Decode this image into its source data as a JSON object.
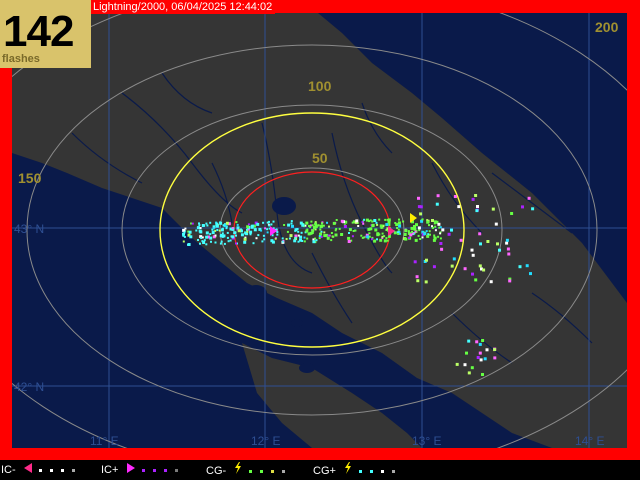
{
  "header": {
    "title": "Lightning/2000, 06/04/2025 12:44:02",
    "flash_count": "142",
    "flash_unit": "flashes"
  },
  "map": {
    "range_rings": [
      {
        "label": "50",
        "color": "#aaaaaa"
      },
      {
        "label": "100",
        "color": "#aaaaaa"
      },
      {
        "label": "150",
        "color": "#aaaaaa"
      },
      {
        "label": "200",
        "color": "#aaaaaa"
      }
    ],
    "alarm_rings": [
      {
        "color": "#ff2020"
      },
      {
        "color": "#ffff40"
      }
    ],
    "latitude_labels": [
      "43° N",
      "42° N"
    ],
    "longitude_labels": [
      "11° E",
      "12° E",
      "13° E",
      "14° E"
    ],
    "colors": {
      "frame": "#ff0000",
      "sea": "#0a1a4a",
      "land": "#353535",
      "grid": "#2e4f93",
      "ring_label": "#a09030"
    }
  },
  "legend": [
    {
      "label": "IC-",
      "marker": "left-triangle",
      "color": "#ff2a8a",
      "dots": [
        "#ffffff",
        "#ffffff",
        "#ffffff",
        "#aaaaaa"
      ]
    },
    {
      "label": "IC+",
      "marker": "right-triangle",
      "color": "#ff2aff",
      "dots": [
        "#aa22ff",
        "#aa22ff",
        "#aa22ff",
        "#7a7a7a"
      ]
    },
    {
      "label": "CG-",
      "marker": "bolt",
      "color": "#ffee00",
      "dots": [
        "#66ff44",
        "#66ff44",
        "#dddd44",
        "#aaaaaa"
      ]
    },
    {
      "label": "CG+",
      "marker": "bolt",
      "color": "#ffee00",
      "dots": [
        "#44ffff",
        "#44ffff",
        "#ffffff",
        "#aaaaaa"
      ]
    }
  ]
}
